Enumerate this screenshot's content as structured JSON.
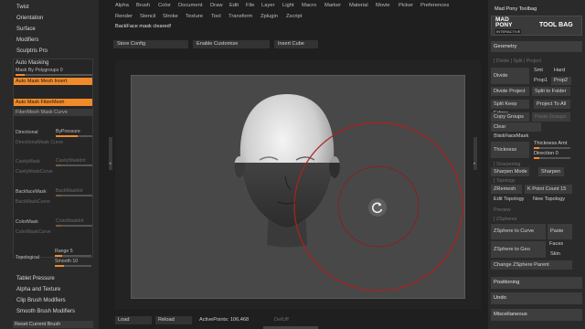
{
  "left_panel": {
    "top_items": [
      "Twist",
      "Orientation",
      "Surface",
      "Modifiers",
      "Sculptris Pro"
    ],
    "section_title": "Auto Masking",
    "mask_by_polygroups": {
      "label": "Mask By Polygroups",
      "value": "0",
      "fraction": 0.0
    },
    "auto_mask_mesh_insert": "Auto Mask Mesh Insert",
    "auto_mask_fibermesh": "Auto Mask FiberMesh",
    "fibermesh_mask_curve": "FiberMesh Mask Curve",
    "directional": "Directional",
    "by_pressure": "ByPressure",
    "directional_mask_curve": "DirectionalMask Curve",
    "cavity_mask": "CavityMask",
    "cavity_mask_int": "CavityMaskInt",
    "cavity_mask_curve": "CavityMaskCurve",
    "backface_mask": "BackfaceMask",
    "backface_mask_int": "BackMaskInt",
    "backface_mask_curve": "BackMaskCurve",
    "color_mask": "ColorMask",
    "color_mask_int": "ColorMaskInt",
    "color_mask_curve": "ColorMaskCurve",
    "topological": "Topological",
    "range": {
      "label": "Range",
      "value": "5"
    },
    "smooth": {
      "label": "Smooth",
      "value": "10"
    },
    "bottom_items": [
      "Tablet Pressure",
      "Alpha and Texture",
      "Clip Brush Modifiers",
      "Smooth Brush Modifiers"
    ],
    "reset_current_brush": "Reset Current Brush"
  },
  "top_menu": {
    "row1": [
      "Alpha",
      "Brush",
      "Color",
      "Document",
      "Draw",
      "Edit",
      "File",
      "Layer",
      "Light",
      "Macro",
      "Marker",
      "Material",
      "Movie",
      "Picker",
      "Preferences"
    ],
    "row2": [
      "Render",
      "Stencil",
      "Stroke",
      "Texture",
      "Tool",
      "Transform",
      "Zplugin",
      "Zscript"
    ]
  },
  "notice": "BackFace mask cleared!",
  "toolbar": {
    "store_config": "Store Config",
    "enable_customize": "Enable Customize",
    "insert_cube": "Insert Cube"
  },
  "bottom_bar": {
    "load": "Load",
    "reload": "Reload",
    "active_points": "ActivePoints: 106,468",
    "defgff": "DefUff"
  },
  "right_panel": {
    "plugin_title": "Mad Pony Toolbag",
    "logo_line1": "MAD",
    "logo_line2": "PONY",
    "logo_line3": "INTERACTIVE",
    "logo_right": "TOOL BAG",
    "geometry": "Geometry",
    "divide_split_project": "[ Divide | Split | Project",
    "divide": "Divide",
    "smt": "Smt",
    "hard": "Hard",
    "prop1": "Prop1",
    "prop2": "Prop2",
    "divide_project": "Divide Project",
    "split_to_folder": "Split to Folder",
    "split_keep_edges": "Split Keep Edges",
    "project_to_all": "Project To All",
    "copy_groups": "Copy Groups",
    "paste_groups": "Paste Groups",
    "clear_backfacemask": "Clear BackFaceMask",
    "thickness_section": "[ Thickness",
    "thickness": "Thickness",
    "thickness_amt": "Thickness Amt",
    "direction": {
      "label": "Direction",
      "value": "0"
    },
    "sharpening_section": "[ Sharpening",
    "sharpen_mode": "Sharpen Mode",
    "sharpen": "Sharpen",
    "topology_section": "[ Topology",
    "zremesh": "ZRemesh",
    "k_point_count": {
      "label": "K Point Count",
      "value": "15"
    },
    "edit_topology": "Edit Topology",
    "new_topology": "New Topology",
    "preview": "Preview",
    "zspheres_section": "[ ZSpheres",
    "zsphere_to_curve": "ZSphere to Curve",
    "paste": "Paste",
    "zsphere_to_geo": "ZSphere to Geo",
    "faces": "Faces",
    "skin": "Skin",
    "change_zsphere_parent": "Change ZSphere Parent",
    "positioning": "Positioning",
    "undo": "Undo",
    "miscellaneous": "Miscellaneous"
  },
  "colors": {
    "accent": "#f08a2a",
    "canvas": "#484848",
    "panel": "#2a2a2a"
  }
}
